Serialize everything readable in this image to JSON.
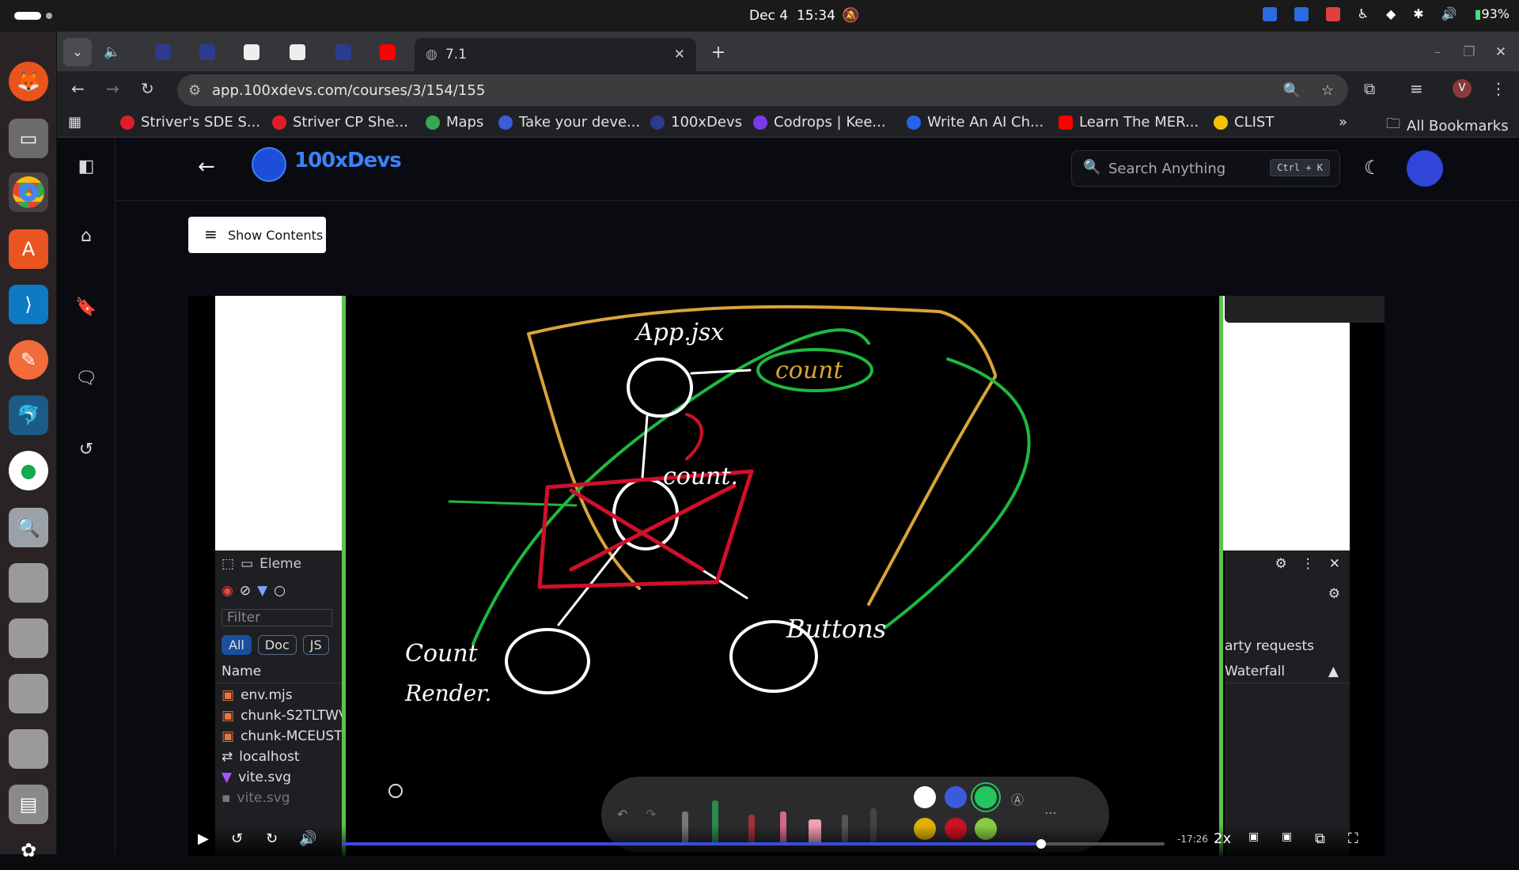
{
  "system": {
    "date": "Dec 4",
    "time": "15:34",
    "battery": "93%"
  },
  "tabs": [
    {
      "label": "",
      "color": "#2b3b8f"
    },
    {
      "label": "",
      "color": "#2b3b8f"
    },
    {
      "label": "",
      "color": "#eeeeee"
    },
    {
      "label": "",
      "color": "#eeeeee"
    },
    {
      "label": "",
      "color": "#2b3b8f"
    },
    {
      "label": "",
      "color": "#ff0000"
    },
    {
      "label": "7.1",
      "color": "#9aa0a6"
    }
  ],
  "address": {
    "url": "app.100xdevs.com/courses/3/154/155",
    "profile_initial": "V"
  },
  "bookmarks": [
    {
      "label": "Striver's SDE S...",
      "color": "#e11d2a"
    },
    {
      "label": "Striver CP She...",
      "color": "#e11d2a"
    },
    {
      "label": "Maps",
      "color": "#34a853"
    },
    {
      "label": "Take your deve...",
      "color": "#3b5bdb"
    },
    {
      "label": "100xDevs",
      "color": "#2b3b8f"
    },
    {
      "label": "Codrops | Kee...",
      "color": "#7c3aed"
    },
    {
      "label": "Write An AI Ch...",
      "color": "#2563eb"
    },
    {
      "label": "Learn The MER...",
      "color": "#ff0000"
    },
    {
      "label": "CLIST",
      "color": "#f5c400"
    }
  ],
  "bookmarks_more": "»",
  "all_bookmarks": "All Bookmarks",
  "app": {
    "brand": "100xDevs",
    "search_placeholder": "Search Anything",
    "search_shortcut": "Ctrl + K",
    "show_contents": "Show Contents"
  },
  "devtools_left": {
    "tab_label": "Eleme",
    "filter_placeholder": "Filter",
    "chips": [
      "All",
      "Doc",
      "JS"
    ],
    "column": "Name",
    "rows": [
      "env.mjs",
      "chunk-S2TLTWV",
      "chunk-MCEUST",
      "localhost",
      "vite.svg",
      "vite.svg"
    ]
  },
  "devtools_right": {
    "requests_label": "arty requests",
    "waterfall": "Waterfall"
  },
  "whiteboard": {
    "labels": [
      "App.jsx",
      "count",
      "count.",
      "Count",
      "Render.",
      "Buttons"
    ]
  },
  "toolbar_colors": [
    "#ffffff",
    "#3b5bdb",
    "#22c55e",
    "#e0b000",
    "#cc1122",
    "#88cc44"
  ],
  "player": {
    "time_remaining": "-17:26",
    "speed": "2x",
    "progress": 0.85
  }
}
